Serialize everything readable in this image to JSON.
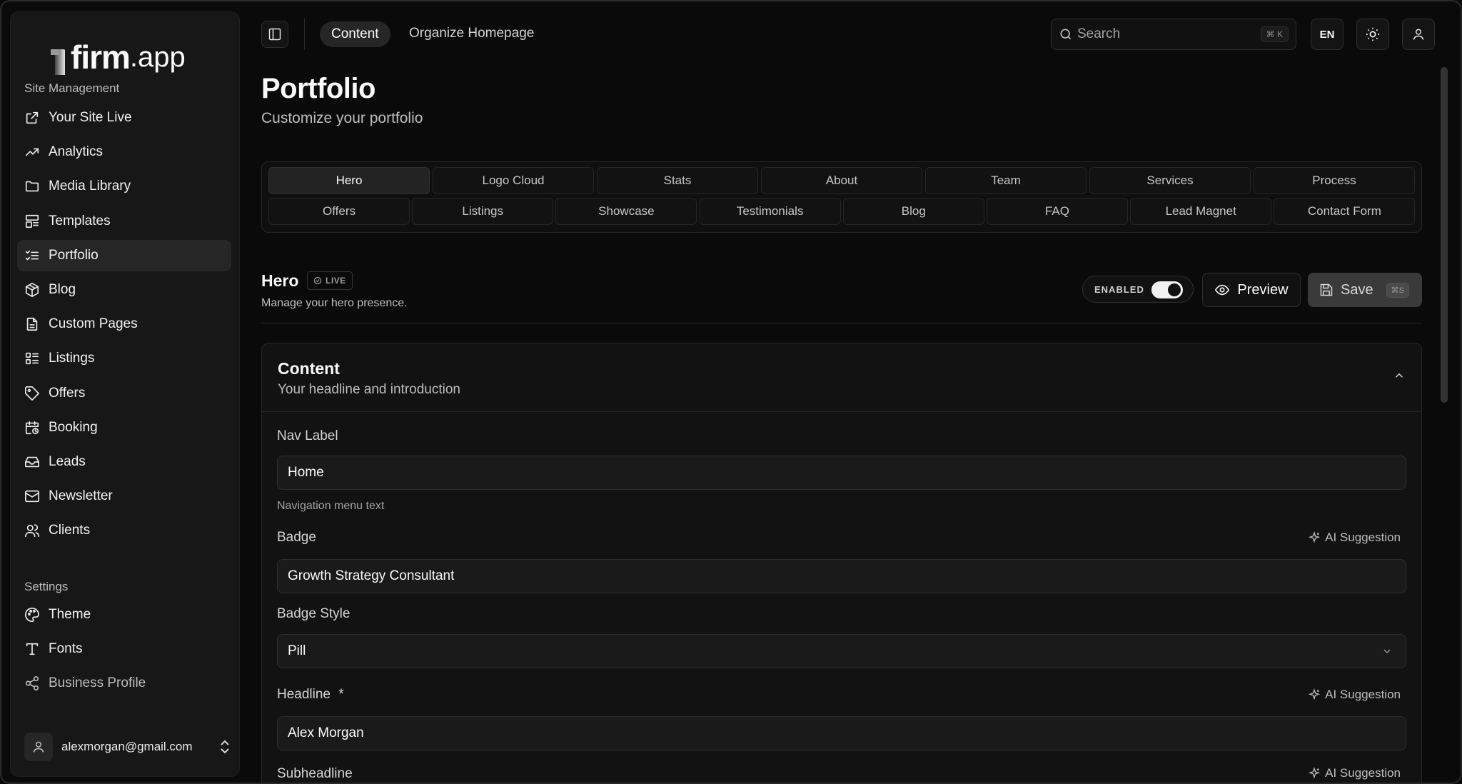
{
  "sidebar": {
    "logo": {
      "main": "firm",
      "suffix": ".app"
    },
    "site_section": "Site Management",
    "site_items": [
      {
        "label": "Your Site Live",
        "icon": "external-link-icon"
      },
      {
        "label": "Analytics",
        "icon": "trending-up-icon"
      },
      {
        "label": "Media Library",
        "icon": "folder-icon"
      },
      {
        "label": "Templates",
        "icon": "layout-icon"
      },
      {
        "label": "Portfolio",
        "icon": "list-checks-icon",
        "active": true
      },
      {
        "label": "Blog",
        "icon": "box-icon"
      },
      {
        "label": "Custom Pages",
        "icon": "file-text-icon"
      },
      {
        "label": "Listings",
        "icon": "list-icon"
      },
      {
        "label": "Offers",
        "icon": "tag-icon"
      },
      {
        "label": "Booking",
        "icon": "calendar-clock-icon"
      },
      {
        "label": "Leads",
        "icon": "inbox-icon"
      },
      {
        "label": "Newsletter",
        "icon": "mail-icon"
      },
      {
        "label": "Clients",
        "icon": "users-icon"
      }
    ],
    "settings_section": "Settings",
    "settings_items": [
      {
        "label": "Theme",
        "icon": "palette-icon"
      },
      {
        "label": "Fonts",
        "icon": "type-icon"
      },
      {
        "label": "Business Profile",
        "icon": "share-icon"
      }
    ],
    "user_email": "alexmorgan@gmail.com"
  },
  "topbar": {
    "crumb_active": "Content",
    "crumb_link": "Organize Homepage",
    "search_placeholder": "Search",
    "search_shortcut": "⌘ K",
    "language": "EN"
  },
  "page": {
    "title": "Portfolio",
    "subtitle": "Customize your portfolio"
  },
  "tabs": {
    "row1": [
      "Hero",
      "Logo Cloud",
      "Stats",
      "About",
      "Team",
      "Services",
      "Process"
    ],
    "row2": [
      "Offers",
      "Listings",
      "Showcase",
      "Testimonials",
      "Blog",
      "FAQ",
      "Lead Magnet",
      "Contact Form"
    ],
    "active": "Hero"
  },
  "section": {
    "title": "Hero",
    "badge": "LIVE",
    "subtitle": "Manage your hero presence.",
    "toggle_label": "ENABLED",
    "toggle_on": true,
    "preview_label": "Preview",
    "save_label": "Save",
    "save_shortcut": "⌘S"
  },
  "card": {
    "title": "Content",
    "subtitle": "Your headline and introduction",
    "ai_label": "AI Suggestion",
    "fields": {
      "nav_label": {
        "label": "Nav Label",
        "value": "Home",
        "help": "Navigation menu text"
      },
      "badge": {
        "label": "Badge",
        "value": "Growth Strategy Consultant"
      },
      "badge_style": {
        "label": "Badge Style",
        "value": "Pill"
      },
      "headline": {
        "label": "Headline",
        "required_mark": "*",
        "value": "Alex Morgan"
      },
      "subheadline": {
        "label": "Subheadline"
      }
    }
  }
}
